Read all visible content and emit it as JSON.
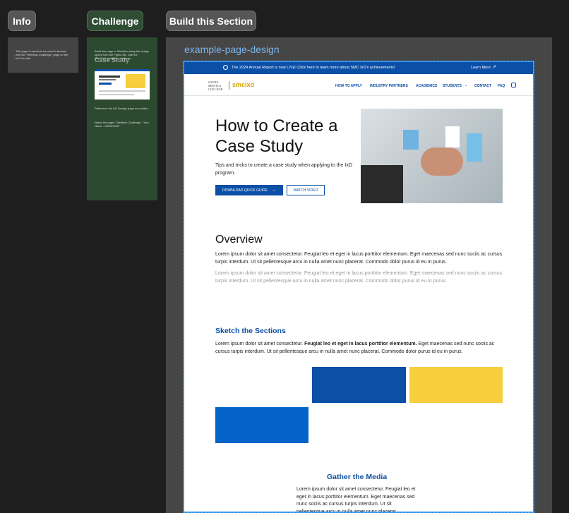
{
  "tabs": {
    "info": "Info",
    "challenge": "Challenge",
    "build": "Build this Section"
  },
  "info_panel": {
    "text": "This page is meant to be used in tandem with the \"Webflow Challenge\" page on the IxD doc site."
  },
  "challenge_panel": {
    "heading": "Build this page in Webflow using the design specs from the Figma file. Use the Flex/Grid guide for reference.",
    "mini_title": "Case Study",
    "reference": "Reference the IxD Design page as needed.",
    "name_note": "Name the page: \"Webflow Challenge - Your Name - 05/30/2025\""
  },
  "frame_title": "example-page-design",
  "site": {
    "banner_text": "The 2024 Annual Report is now LIVE! Click here to learn more about SMC IxD's achievements!",
    "banner_link": "Learn More",
    "logo_text": "SANTA MONICA COLLEGE",
    "logo_mark": "smcixd",
    "nav": [
      "HOW TO APPLY",
      "INDUSTRY PARTNERS",
      "ACADEMICS",
      "STUDENTS",
      "CONTACT",
      "FAQ"
    ],
    "hero_title": "How to Create a Case Study",
    "hero_subtitle": "Tips and tricks to create a case study when applying to the IxD program.",
    "hero_primary": "DOWNLOAD QUICK GUIDE",
    "hero_secondary": "WATCH VIDEO",
    "overview_heading": "Overview",
    "overview_p1": "Lorem ipsum dolor sit amet consectetur. Feugiat leo et eget in lacus porttitor elementum. Eget maecenas sed nunc sociis ac cursus turpis interdum. Ut sit pellentesque arcu in nulla amet nunc placerat. Commodo dolor purus id eu in purus.",
    "overview_p2": "Lorem ipsum dolor sit amet consectetur. Feugiat leo et eget in lacus porttitor elementum. Eget maecenas sed nunc sociis ac cursus turpis interdum. Ut sit pellentesque arcu in nulla amet nunc placerat. Commodo dolor purus id eu in purus.",
    "sketch_heading": "Sketch the Sections",
    "sketch_lead": "Lorem ipsum dolor sit amet consectetur.",
    "sketch_bold": "Feugiat leo et eget in lacus porttitor elementum.",
    "sketch_rest": "Eget maecenas sed nunc sociis ac cursus turpis interdum. Ut sit pellentesque arcu in nulla amet nunc placerat. Commodo dolor purus id eu in purus.",
    "gather_heading": "Gather the Media",
    "gather_text": "Lorem ipsum dolor sit amet consectetur. Feugiat leo et eget in lacus porttitor elementum. Eget maecenas sed nunc sociis ac cursus turpis interdum. Ut sit pellentesque arcu in nulla amet nunc placerat."
  },
  "colors": {
    "blue": "#0b4fa6",
    "bright_blue": "#0463c9",
    "yellow": "#f7ce3e"
  }
}
